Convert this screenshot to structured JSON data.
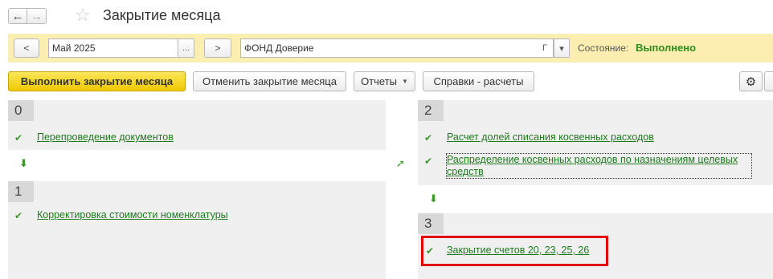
{
  "header": {
    "title": "Закрытие месяца",
    "back_icon": "←",
    "forward_icon": "→",
    "favorite_icon": "☆"
  },
  "params": {
    "prev_label": "<",
    "period_value": "Май 2025",
    "period_pick_label": "...",
    "next_label": ">",
    "org_value": "ФОНД Доверие",
    "org_open_label": "Г",
    "org_dropdown_label": "▾",
    "state_label": "Состояние:",
    "state_value": "Выполнено"
  },
  "toolbar": {
    "run_label": "Выполнить закрытие месяца",
    "cancel_label": "Отменить закрытие месяца",
    "reports_label": "Отчеты",
    "reference_label": "Справки - расчеты",
    "settings_icon": "⚙"
  },
  "steps": [
    {
      "number": "0",
      "tasks": [
        {
          "label": "Перепроведение документов",
          "status": "done"
        }
      ]
    },
    {
      "number": "1",
      "tasks": [
        {
          "label": "Корректировка стоимости номенклатуры",
          "status": "done"
        }
      ]
    },
    {
      "number": "2",
      "tasks": [
        {
          "label": "Расчет долей списания косвенных расходов",
          "status": "done"
        },
        {
          "label_line1": "Распределение косвенных расходов по назначениям целевых",
          "label_line2": "средств",
          "status": "done"
        }
      ]
    },
    {
      "number": "3",
      "tasks": [
        {
          "label": "Закрытие счетов 20, 23, 25, 26",
          "status": "done"
        }
      ]
    }
  ],
  "glyphs": {
    "check": "✔",
    "down_arrow": "⬇",
    "diag_arrow": "➚"
  },
  "colors": {
    "accent_yellow": "#f0c800",
    "param_bar": "#fbeeb0",
    "link_green": "#1f7a1f",
    "status_green": "#2e8b1e",
    "highlight_red": "#e00000"
  }
}
